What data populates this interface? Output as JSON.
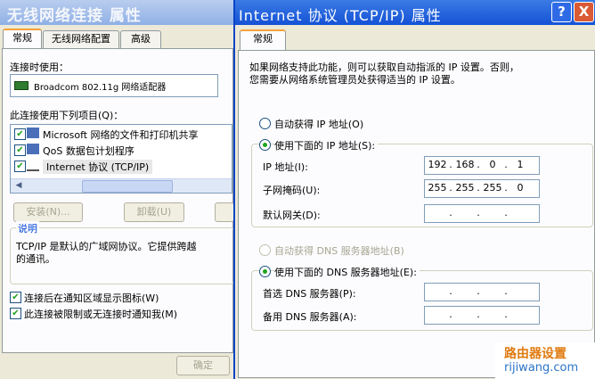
{
  "back_window": {
    "title": "无线网络连接 属性",
    "tabs": [
      "常规",
      "无线网络配置",
      "高级"
    ],
    "connect_using_label": "连接时使用：",
    "adapter_name": "Broadcom 802.11g 网络适配器",
    "items_label": "此连接使用下列项目(Q)：",
    "items": [
      {
        "label": "Microsoft 网络的文件和打印机共享",
        "checked": true
      },
      {
        "label": "QoS 数据包计划程序",
        "checked": true
      },
      {
        "label": "Internet 协议 (TCP/IP)",
        "checked": true
      }
    ],
    "install_button": "安装(N)...",
    "uninstall_button": "卸载(U)",
    "description_title": "说明",
    "description_text_1": "TCP/IP 是默认的广域网协议。它提供跨越",
    "description_text_2": "的通讯。",
    "show_icon_label": "连接后在通知区域显示图标(W)",
    "notify_limited_label": "此连接被限制或无连接时通知我(M)",
    "ok_button": "确定"
  },
  "front_window": {
    "title": "Internet 协议 (TCP/IP) 属性",
    "help_button": "?",
    "close_button": "X",
    "tab": "常规",
    "intro_1": "如果网络支持此功能，则可以获取自动指派的 IP 设置。否则，",
    "intro_2": "您需要从网络系统管理员处获得适当的 IP 设置。",
    "auto_ip_label": "自动获得 IP 地址(O)",
    "manual_ip_label": "使用下面的 IP 地址(S):",
    "ip_label": "IP 地址(I):",
    "ip": [
      "192",
      "168",
      "0",
      "1"
    ],
    "mask_label": "子网掩码(U):",
    "mask": [
      "255",
      "255",
      "255",
      "0"
    ],
    "gateway_label": "默认网关(D):",
    "gateway": [
      "",
      "",
      "",
      ""
    ],
    "auto_dns_label": "自动获得 DNS 服务器地址(B)",
    "manual_dns_label": "使用下面的 DNS 服务器地址(E):",
    "pref_dns_label": "首选 DNS 服务器(P):",
    "pref_dns": [
      "",
      "",
      "",
      ""
    ],
    "alt_dns_label": "备用 DNS 服务器(A):",
    "alt_dns": [
      "",
      "",
      "",
      ""
    ],
    "dot": "."
  },
  "watermark": {
    "line1": "路由器设置",
    "line2": "rijiwang.com"
  }
}
